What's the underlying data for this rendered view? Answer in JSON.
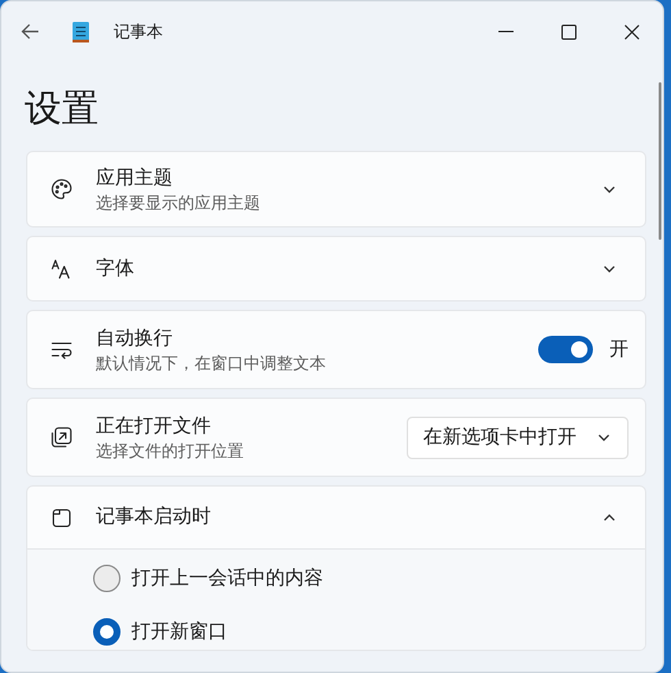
{
  "window": {
    "title": "记事本"
  },
  "heading": "设置",
  "settings": [
    {
      "kind": "expander",
      "title": "应用主题",
      "subtitle": "选择要显示的应用主题",
      "expanded": false
    },
    {
      "kind": "expander",
      "title": "字体",
      "expanded": false
    },
    {
      "kind": "toggle",
      "title": "自动换行",
      "subtitle": "默认情况下，在窗口中调整文本",
      "on": true,
      "state_label": "开"
    },
    {
      "kind": "dropdown",
      "title": "正在打开文件",
      "subtitle": "选择文件的打开位置",
      "value": "在新选项卡中打开"
    },
    {
      "kind": "expander",
      "title": "记事本启动时",
      "expanded": true,
      "options": [
        {
          "label": "打开上一会话中的内容",
          "selected": false
        },
        {
          "label": "打开新窗口",
          "selected": true
        }
      ]
    }
  ]
}
